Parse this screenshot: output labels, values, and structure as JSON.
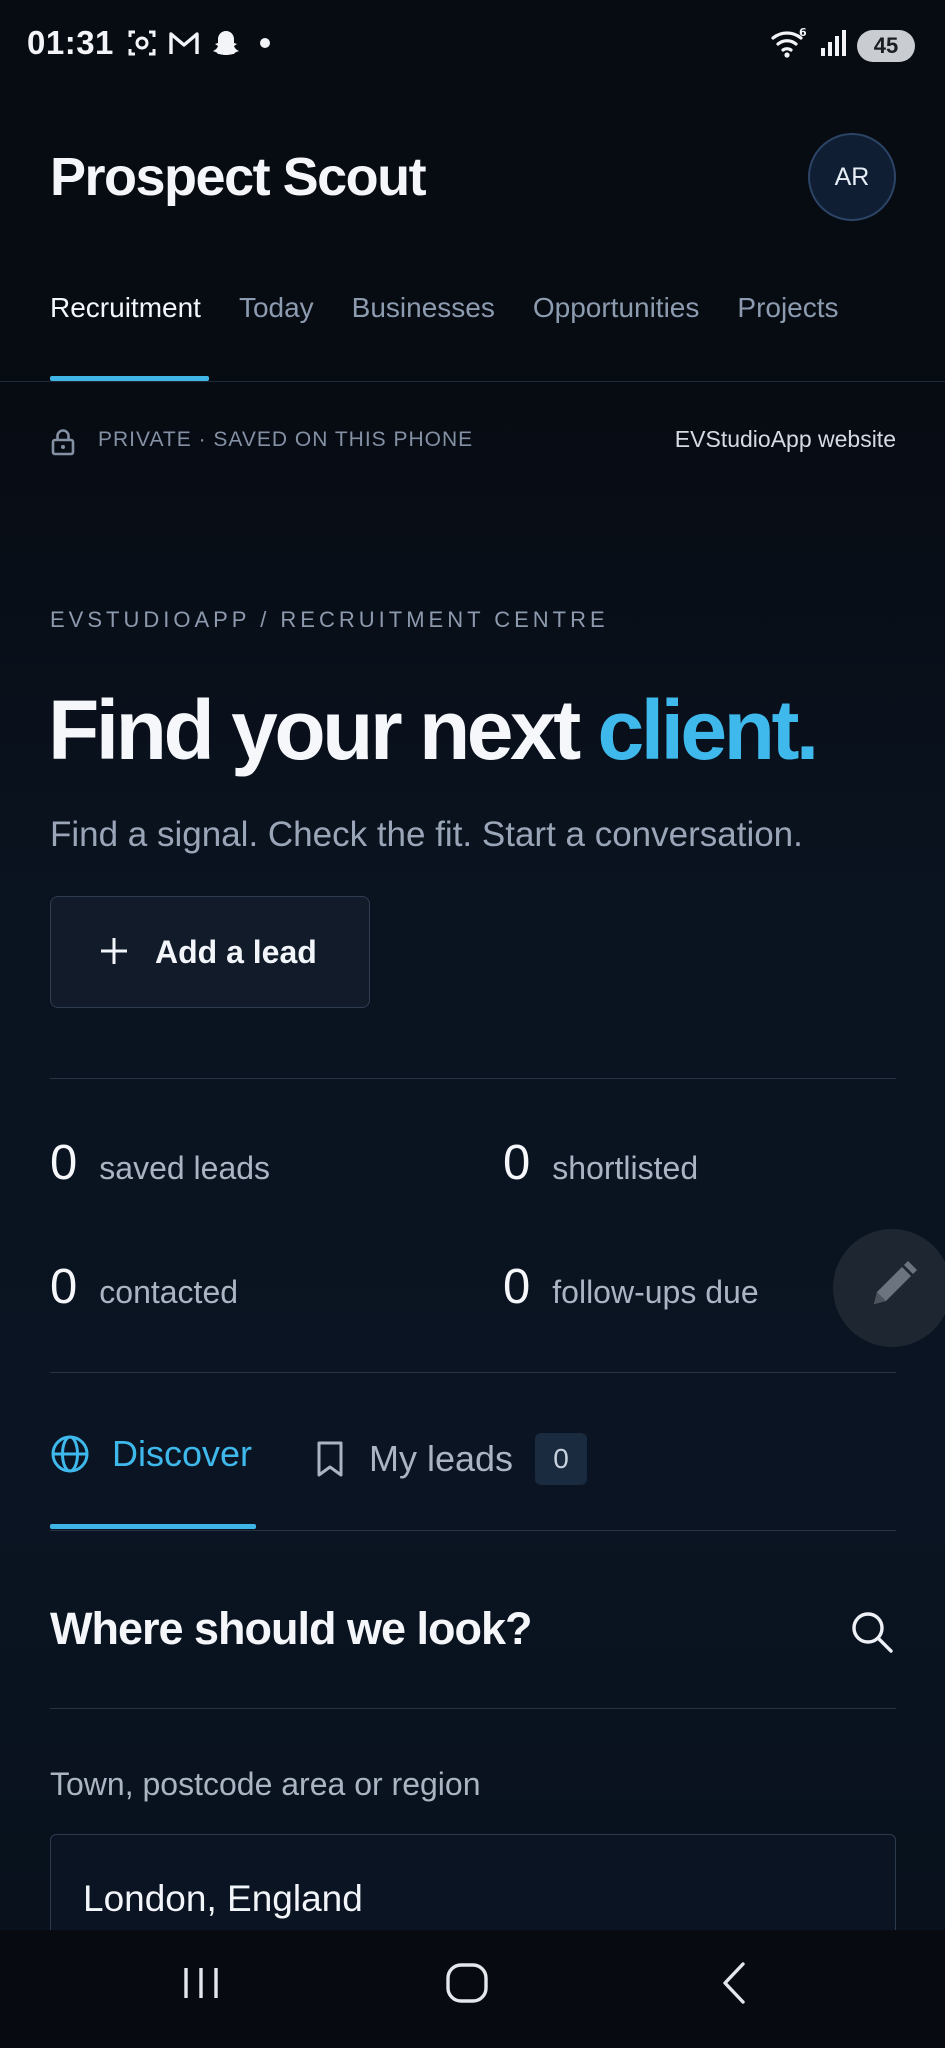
{
  "status_bar": {
    "time": "01:31",
    "left_icons": [
      "screenshot-icon",
      "gmail-icon",
      "snapchat-icon",
      "notification-dot"
    ],
    "right_icons": [
      "wifi-6-icon",
      "signal-icon"
    ],
    "battery": "45"
  },
  "header": {
    "app_title": "Prospect Scout",
    "avatar_initials": "AR",
    "tabs": [
      {
        "label": "Recruitment",
        "active": true
      },
      {
        "label": "Today",
        "active": false
      },
      {
        "label": "Businesses",
        "active": false
      },
      {
        "label": "Opportunities",
        "active": false
      },
      {
        "label": "Projects",
        "active": false
      }
    ]
  },
  "privacy": {
    "text": "PRIVATE · SAVED ON THIS PHONE",
    "link": "EVStudioApp website"
  },
  "hero": {
    "breadcrumb": "EVSTUDIOAPP / RECRUITMENT CENTRE",
    "title_main": "Find your next ",
    "title_accent": "client.",
    "subtitle": "Find a signal. Check the fit. Start a conversation.",
    "add_button": "Add a lead"
  },
  "stats": [
    {
      "value": "0",
      "label": "saved leads"
    },
    {
      "value": "0",
      "label": "shortlisted"
    },
    {
      "value": "0",
      "label": "contacted"
    },
    {
      "value": "0",
      "label": "follow-ups due"
    }
  ],
  "segments": {
    "discover": "Discover",
    "my_leads": "My leads",
    "my_leads_count": "0"
  },
  "search": {
    "title": "Where should we look?",
    "field_label": "Town, postcode area or region",
    "value": "London, England"
  },
  "colors": {
    "accent": "#3fb9ec",
    "background": "#070b12"
  }
}
